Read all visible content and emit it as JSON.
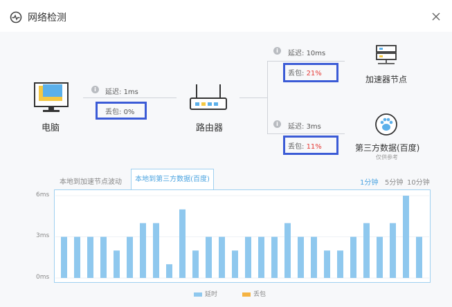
{
  "window": {
    "title": "网络检测"
  },
  "devices": {
    "pc": {
      "label": "电脑"
    },
    "router": {
      "label": "路由器"
    },
    "accel": {
      "label": "加速器节点"
    },
    "third": {
      "label": "第三方数据(百度)",
      "sublabel": "仅供参考"
    }
  },
  "links": {
    "pc_router": {
      "latency_key": "延迟:",
      "latency_val": "1ms",
      "loss_key": "丢包:",
      "loss_val": "0%"
    },
    "router_accel": {
      "latency_key": "延迟:",
      "latency_val": "10ms",
      "loss_key": "丢包:",
      "loss_val": "21%"
    },
    "router_third": {
      "latency_key": "延迟:",
      "latency_val": "3ms",
      "loss_key": "丢包:",
      "loss_val": "11%"
    }
  },
  "tabs": [
    {
      "label": "本地到加速节点波动"
    },
    {
      "label": "本地到第三方数据(百度)"
    }
  ],
  "ranges": [
    {
      "label": "1分钟"
    },
    {
      "label": "5分钟"
    },
    {
      "label": "10分钟"
    }
  ],
  "colors": {
    "latency": "#8fc8ee",
    "loss": "#f5b342",
    "highlight": "#3b5bd6",
    "accent": "#4aa3e0"
  },
  "chart_data": {
    "type": "bar",
    "yticks": [
      "6ms",
      "3ms",
      "0ms"
    ],
    "ylim": [
      0,
      6
    ],
    "series": [
      {
        "name": "延时",
        "values": [
          3,
          3,
          3,
          3,
          2,
          3,
          4,
          4,
          1,
          5,
          2,
          3,
          3,
          2,
          3,
          3,
          3,
          4,
          3,
          3,
          2,
          2,
          3,
          4,
          3,
          4,
          6,
          3
        ]
      },
      {
        "name": "丢包",
        "values": []
      }
    ]
  }
}
